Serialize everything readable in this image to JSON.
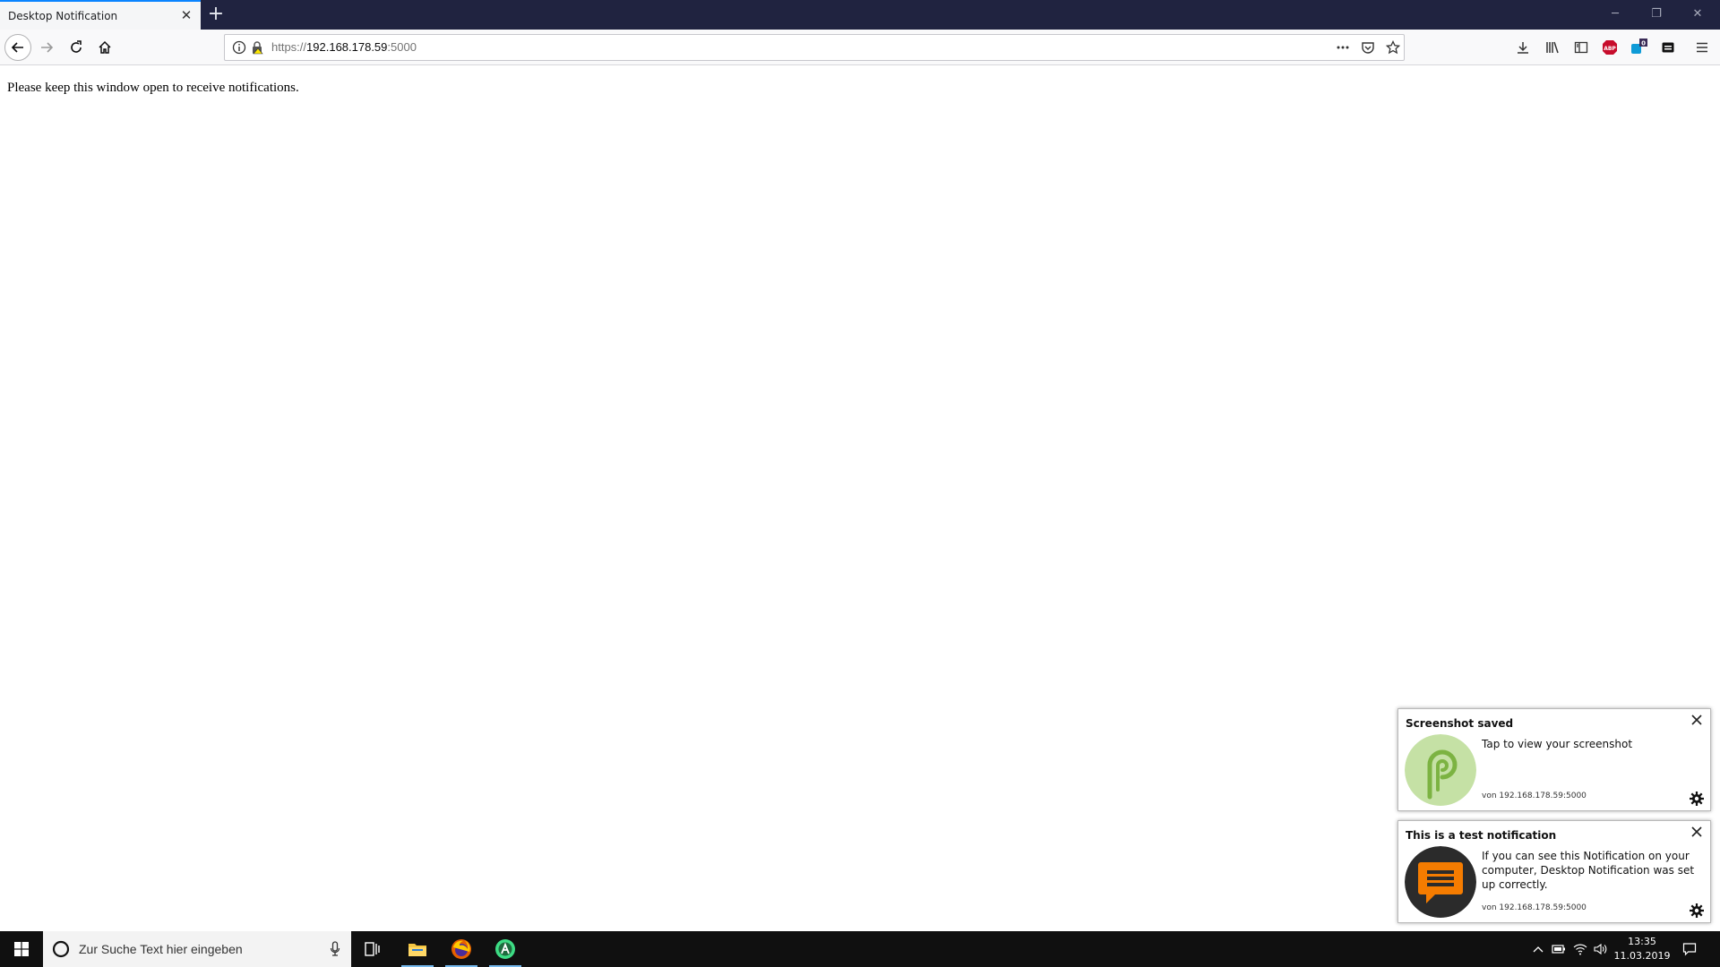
{
  "browser": {
    "tab": {
      "title": "Desktop Notification",
      "close_glyph": "✕"
    },
    "new_tab_glyph": "+",
    "window_controls": {
      "minimize": "─",
      "restore": "❐",
      "close": "✕"
    },
    "url": {
      "scheme": "https://",
      "host": "192.168.178.59",
      "port": ":5000"
    },
    "toolbar_icons": [
      "download-icon",
      "library-icon",
      "sidebar-icon",
      "adblock-icon",
      "extension-badge-icon",
      "reader-icon",
      "menu-icon"
    ],
    "badge_count": "0",
    "adblock_label": "ABP"
  },
  "page": {
    "message": "Please keep this window open to receive notifications."
  },
  "notifications": [
    {
      "title": "Screenshot saved",
      "body": "Tap to view your screenshot",
      "origin": "von 192.168.178.59:5000",
      "avatar_letter": "P",
      "avatar_color": "#c5e1a5",
      "accent_color": "#7cb342"
    },
    {
      "title": "This is a test notification",
      "body": "If you can see this Notification on your computer, Desktop Notification was set up correctly.",
      "origin": "von 192.168.178.59:5000",
      "avatar_color": "#2b2b2b",
      "accent_color": "#f57c00"
    }
  ],
  "taskbar": {
    "search_placeholder": "Zur Suche Text hier eingeben",
    "time": "13:35",
    "date": "11.03.2019",
    "accent_color": "#76b9ed"
  }
}
